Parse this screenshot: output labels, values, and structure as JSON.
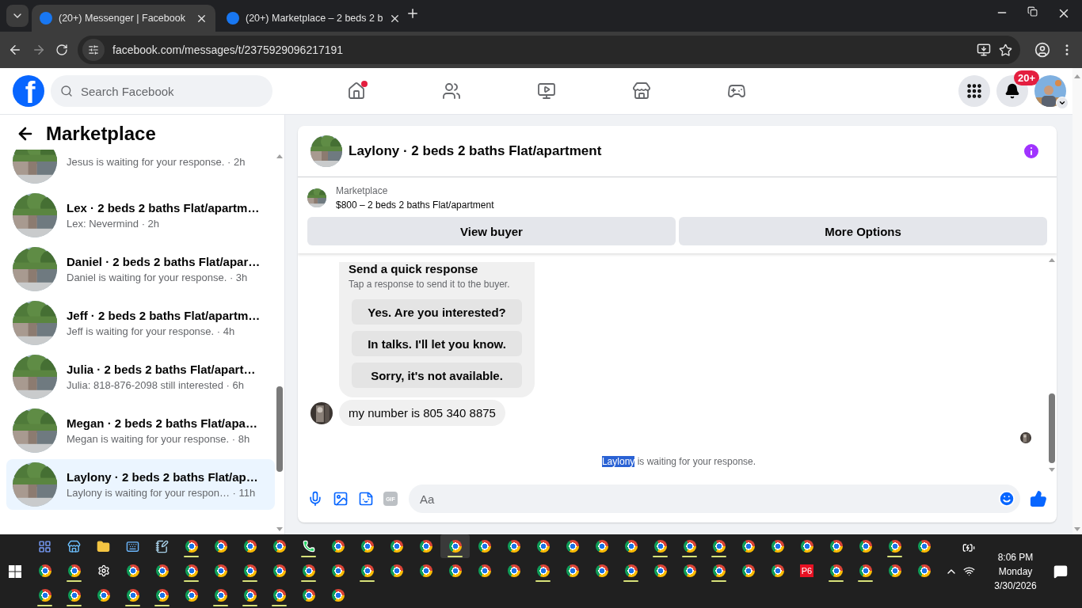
{
  "browser": {
    "tabs": [
      {
        "title": "(20+) Messenger | Facebook",
        "selected": true
      },
      {
        "title": "(20+) Marketplace – 2 beds 2 b",
        "selected": false
      }
    ],
    "url": "facebook.com/messages/t/2375929096217191"
  },
  "header": {
    "logo": "f",
    "search_placeholder": "Search Facebook",
    "nav": [
      {
        "kind": "home",
        "dot": true
      },
      {
        "kind": "friends",
        "dot": false
      },
      {
        "kind": "video",
        "dot": false
      },
      {
        "kind": "marketplace",
        "dot": false
      },
      {
        "kind": "gaming",
        "dot": false
      }
    ],
    "notifications_badge": "20+"
  },
  "sidebar": {
    "title": "Marketplace",
    "conversations": [
      {
        "preview": "Jesus is waiting for your response. · 2h",
        "selected": false
      },
      {
        "title": "Lex · 2 beds 2 baths Flat/apartm…",
        "preview": "Lex: Nevermind · 2h",
        "selected": false
      },
      {
        "title": "Daniel · 2 beds 2 baths Flat/apar…",
        "preview": "Daniel is waiting for your response. · 3h",
        "selected": false
      },
      {
        "title": "Jeff · 2 beds 2 baths Flat/apartm…",
        "preview": "Jeff is waiting for your response. · 4h",
        "selected": false
      },
      {
        "title": "Julia · 2 beds 2 baths Flat/apart…",
        "preview": "Julia: 818-876-2098 still interested · 6h",
        "selected": false
      },
      {
        "title": "Megan · 2 beds 2 baths Flat/apa…",
        "preview": "Megan is waiting for your response. · 8h",
        "selected": false
      },
      {
        "title": "Laylony · 2 beds 2 baths Flat/ap…",
        "preview": "Laylony is waiting for your respon… · 11h",
        "selected": true
      }
    ]
  },
  "chat": {
    "title": "Laylony · 2 beds 2 baths Flat/apartment",
    "listing": {
      "source": "Marketplace",
      "name": "$800 – 2 beds 2 baths Flat/apartment"
    },
    "buttons": [
      "View buyer",
      "More Options"
    ],
    "quick_response": {
      "title": "Send a quick response",
      "subtitle": "Tap a response to send it to the buyer.",
      "options": [
        "Yes. Are you interested?",
        "In talks. I'll let you know.",
        "Sorry, it's not available."
      ]
    },
    "message": "my number is 805 340 8875",
    "status": {
      "selected_text": "Laylony",
      "rest": "is waiting for your response."
    },
    "composer": {
      "gif_label": "GIF",
      "placeholder": "Aa"
    }
  },
  "taskbar": {
    "rows": [
      [
        {
          "kind": "copilot",
          "open": false,
          "active": false
        },
        {
          "kind": "store",
          "open": false,
          "active": false
        },
        {
          "kind": "explorer",
          "open": false,
          "active": false
        },
        {
          "kind": "keyboard",
          "open": false,
          "active": false
        },
        {
          "kind": "notepad",
          "open": false,
          "active": false
        },
        {
          "kind": "chrome",
          "open": true,
          "active": false
        },
        {
          "kind": "chrome",
          "open": false,
          "active": false
        },
        {
          "kind": "chrome",
          "open": false,
          "active": false
        },
        {
          "kind": "chrome",
          "open": false,
          "active": false
        },
        {
          "kind": "whatsapp",
          "open": true,
          "active": false
        },
        {
          "kind": "chrome",
          "open": false,
          "active": false
        },
        {
          "kind": "chrome",
          "open": false,
          "active": false
        },
        {
          "kind": "chrome",
          "open": false,
          "active": false
        },
        {
          "kind": "chrome",
          "open": false,
          "active": false
        },
        {
          "kind": "chrome",
          "open": true,
          "active": true
        },
        {
          "kind": "chrome",
          "open": false,
          "active": false
        },
        {
          "kind": "chrome",
          "open": false,
          "active": false
        },
        {
          "kind": "chrome",
          "open": false,
          "active": false
        },
        {
          "kind": "chrome",
          "open": false,
          "active": false
        },
        {
          "kind": "chrome",
          "open": false,
          "active": false
        },
        {
          "kind": "chrome",
          "open": false,
          "active": false
        },
        {
          "kind": "chrome",
          "open": true,
          "active": false
        },
        {
          "kind": "chrome",
          "open": true,
          "active": false
        },
        {
          "kind": "chrome",
          "open": true,
          "active": false
        },
        {
          "kind": "chrome",
          "open": false,
          "active": false
        },
        {
          "kind": "chrome",
          "open": false,
          "active": false
        },
        {
          "kind": "chrome",
          "open": false,
          "active": false
        },
        {
          "kind": "chrome",
          "open": false,
          "active": false
        },
        {
          "kind": "chrome",
          "open": false,
          "active": false
        },
        {
          "kind": "chrome",
          "open": true,
          "active": false
        },
        {
          "kind": "chrome",
          "open": false,
          "active": false
        }
      ],
      [
        {
          "kind": "chrome",
          "open": false,
          "active": false
        },
        {
          "kind": "chrome",
          "open": true,
          "active": false
        },
        {
          "kind": "settings",
          "open": false,
          "active": false
        },
        {
          "kind": "chrome",
          "open": false,
          "active": false
        },
        {
          "kind": "chrome",
          "open": false,
          "active": false
        },
        {
          "kind": "chrome",
          "open": true,
          "active": false
        },
        {
          "kind": "chrome",
          "open": false,
          "active": false
        },
        {
          "kind": "chrome",
          "open": true,
          "active": false
        },
        {
          "kind": "chrome",
          "open": false,
          "active": false
        },
        {
          "kind": "chrome",
          "open": true,
          "active": false
        },
        {
          "kind": "chrome",
          "open": false,
          "active": false
        },
        {
          "kind": "chrome",
          "open": true,
          "active": false
        },
        {
          "kind": "chrome",
          "open": false,
          "active": false
        },
        {
          "kind": "chrome",
          "open": false,
          "active": false
        },
        {
          "kind": "chrome",
          "open": false,
          "active": false
        },
        {
          "kind": "chrome",
          "open": false,
          "active": false
        },
        {
          "kind": "chrome",
          "open": false,
          "active": false
        },
        {
          "kind": "chrome",
          "open": true,
          "active": false
        },
        {
          "kind": "chrome",
          "open": false,
          "active": false
        },
        {
          "kind": "chrome",
          "open": false,
          "active": false
        },
        {
          "kind": "chrome",
          "open": true,
          "active": false
        },
        {
          "kind": "chrome",
          "open": false,
          "active": false
        },
        {
          "kind": "chrome",
          "open": false,
          "active": false
        },
        {
          "kind": "chrome",
          "open": true,
          "active": false
        },
        {
          "kind": "chrome",
          "open": false,
          "active": false
        },
        {
          "kind": "chrome",
          "open": false,
          "active": false
        },
        {
          "kind": "label",
          "text": "P6",
          "open": false,
          "active": false
        },
        {
          "kind": "chrome",
          "open": true,
          "active": false
        },
        {
          "kind": "chrome",
          "open": true,
          "active": false
        },
        {
          "kind": "chrome",
          "open": false,
          "active": false
        },
        {
          "kind": "chrome",
          "open": false,
          "active": false
        }
      ],
      [
        {
          "kind": "chrome",
          "open": true,
          "active": false
        },
        {
          "kind": "chrome",
          "open": true,
          "active": false
        },
        {
          "kind": "chrome",
          "open": false,
          "active": false
        },
        {
          "kind": "chrome",
          "open": true,
          "active": false
        },
        {
          "kind": "chrome",
          "open": true,
          "active": false
        },
        {
          "kind": "chrome",
          "open": false,
          "active": false
        },
        {
          "kind": "chrome",
          "open": true,
          "active": false
        },
        {
          "kind": "chrome",
          "open": true,
          "active": false
        },
        {
          "kind": "chrome",
          "open": true,
          "active": false
        },
        {
          "kind": "chrome",
          "open": false,
          "active": false
        },
        {
          "kind": "chrome",
          "open": false,
          "active": false
        }
      ]
    ],
    "time": "8:06 PM",
    "day": "Monday",
    "date": "3/30/2026"
  }
}
